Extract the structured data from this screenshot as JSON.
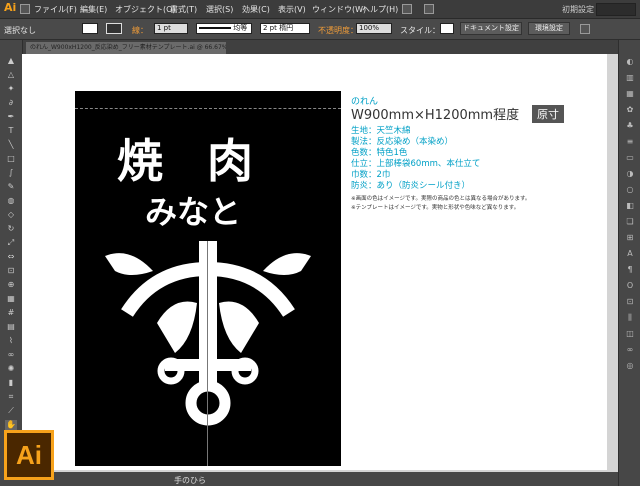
{
  "app": {
    "logo": "Ai",
    "workspace": "初期設定"
  },
  "menu": [
    "ファイル(F)",
    "編集(E)",
    "オブジェクト(O)",
    "書式(T)",
    "選択(S)",
    "効果(C)",
    "表示(V)",
    "ウィンドウ(W)",
    "ヘルプ(H)"
  ],
  "control": {
    "selection": "選択なし",
    "stroke_label": "線：",
    "stroke_value": "1 pt",
    "stroke_profile": "均等",
    "brush": "2 pt 楕円",
    "opacity_label": "不透明度：",
    "opacity_value": "100%",
    "style_label": "スタイル：",
    "doc_setup": "ドキュメント設定",
    "prefs": "環境設定"
  },
  "tab": {
    "filename": "のれん_W900xH1200_反応染め_フリー素材テンプレート.ai @ 66.67% (CMYK/プレビュー)"
  },
  "artwork": {
    "line1": "焼 肉",
    "line2": "みなと"
  },
  "info": {
    "category": "のれん",
    "size": "W900mm×H1200mm程度",
    "badge": "原寸",
    "specs": [
      {
        "label": "生地：",
        "value": "天竺木綿"
      },
      {
        "label": "製法：",
        "value": "反応染め（本染め）"
      },
      {
        "label": "色数：",
        "value": "特色1色"
      },
      {
        "label": "仕立：",
        "value": "上部棒袋60mm、本仕立て"
      },
      {
        "label": "巾数：",
        "value": "2巾"
      },
      {
        "label": "防炎：",
        "value": "あり（防炎シール付き）"
      }
    ],
    "notes": [
      "※画面の色はイメージです。実際の商品の色とは異なる場合があります。",
      "※テンプレートはイメージです。実物と形状や色味など異なります。"
    ]
  },
  "status": {
    "tool": "手のひら"
  },
  "colors": {
    "accent": "#f7a21b",
    "info_cyan": "#00a0c6",
    "canvas": "#ffffff",
    "banner": "#000000"
  }
}
